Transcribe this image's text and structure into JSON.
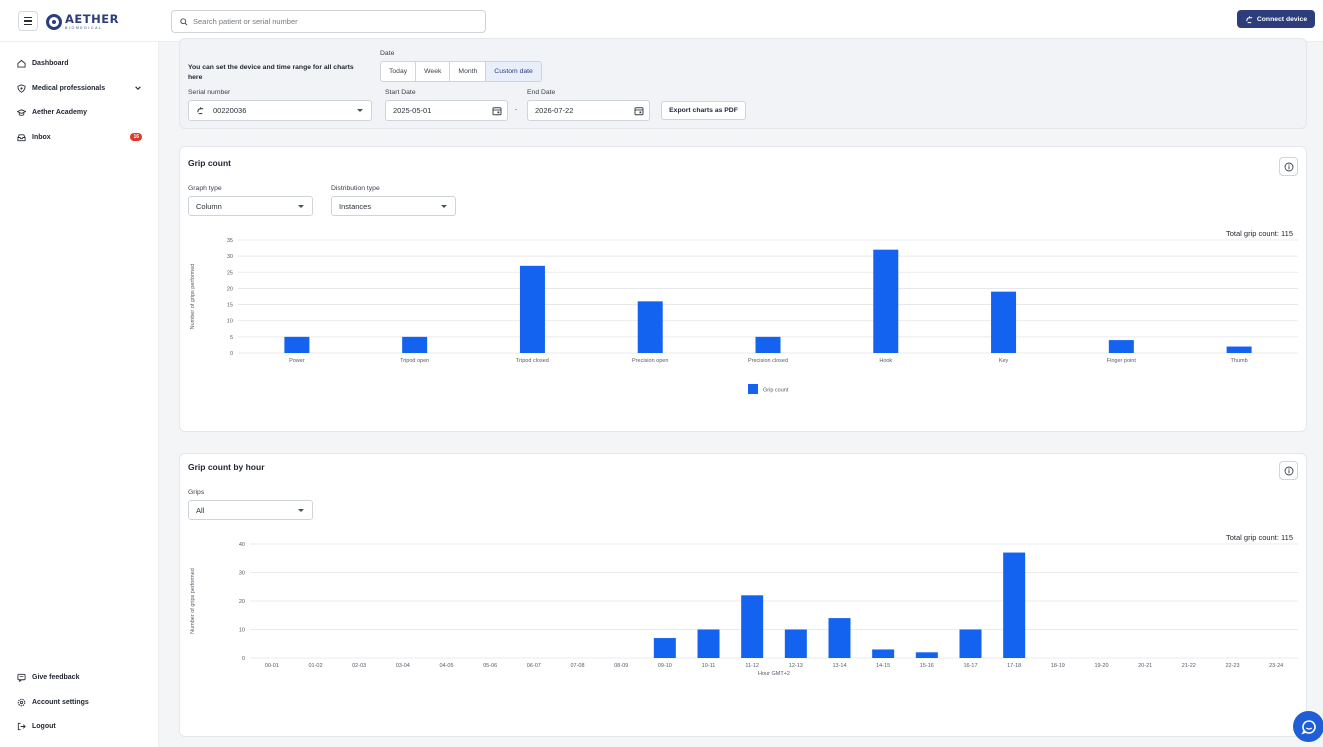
{
  "header": {
    "logo_name": "AETHER",
    "logo_sub": "BIOMEDICAL",
    "search_placeholder": "Search patient or serial number",
    "connect_label": "Connect device"
  },
  "sidebar": {
    "items": [
      {
        "label": "Dashboard",
        "icon": "home-icon"
      },
      {
        "label": "Medical professionals",
        "icon": "shield-icon"
      },
      {
        "label": "Aether Academy",
        "icon": "graduation-cap-icon"
      },
      {
        "label": "Inbox",
        "icon": "inbox-icon",
        "badge": "16"
      }
    ],
    "bottom_items": [
      {
        "label": "Give feedback",
        "icon": "feedback-icon"
      },
      {
        "label": "Account settings",
        "icon": "settings-icon"
      },
      {
        "label": "Logout",
        "icon": "logout-icon"
      }
    ]
  },
  "filters": {
    "description": "You can set the device and time range for all charts here",
    "date_label": "Date",
    "date_options": [
      "Today",
      "Week",
      "Month",
      "Custom date"
    ],
    "date_selected": "Custom date",
    "serial_label": "Serial number",
    "serial_value": "00220036",
    "start_label": "Start Date",
    "start_value": "2025-05-01",
    "end_label": "End Date",
    "end_value": "2026-07-22",
    "range_separator": "-",
    "export_label": "Export charts as PDF"
  },
  "grip_count": {
    "title": "Grip count",
    "graph_type_label": "Graph type",
    "graph_type_value": "Column",
    "distribution_label": "Distribution type",
    "distribution_value": "Instances",
    "total": "Total grip count: 115"
  },
  "grip_hour": {
    "title": "Grip count by hour",
    "grips_label": "Grips",
    "grips_value": "All",
    "total": "Total grip count: 115"
  },
  "colors": {
    "bar": "#1463f0",
    "brand": "#2d3d7c",
    "badge": "#e0362c"
  },
  "chart_data": [
    {
      "type": "bar",
      "ylabel": "Number of grips performed",
      "xlabel": "",
      "ylim": [
        0,
        35
      ],
      "yticks": [
        0,
        5,
        10,
        15,
        20,
        25,
        30,
        35
      ],
      "categories": [
        "Power",
        "Tripod open",
        "Tripod closed",
        "Precision open",
        "Precision closed",
        "Hook",
        "Key",
        "Finger point",
        "Thumb"
      ],
      "series": [
        {
          "name": "Grip count",
          "values": [
            5,
            5,
            27,
            16,
            5,
            32,
            19,
            4,
            2
          ]
        }
      ],
      "legend": "bottom-center",
      "grid": true
    },
    {
      "type": "bar",
      "ylabel": "Number of grips performed",
      "xlabel": "Hour GMT+2",
      "ylim": [
        0,
        40
      ],
      "yticks": [
        0,
        10,
        20,
        30,
        40
      ],
      "categories": [
        "00-01",
        "01-02",
        "02-03",
        "03-04",
        "04-05",
        "05-06",
        "06-07",
        "07-08",
        "08-09",
        "09-10",
        "10-11",
        "11-12",
        "12-13",
        "13-14",
        "14-15",
        "15-16",
        "16-17",
        "17-18",
        "18-19",
        "19-20",
        "20-21",
        "21-22",
        "22-23",
        "23-24"
      ],
      "series": [
        {
          "values": [
            0,
            0,
            0,
            0,
            0,
            0,
            0,
            0,
            0,
            7,
            10,
            22,
            10,
            14,
            3,
            2,
            10,
            37,
            0,
            0,
            0,
            0,
            0,
            0
          ]
        }
      ],
      "grid": true
    }
  ]
}
